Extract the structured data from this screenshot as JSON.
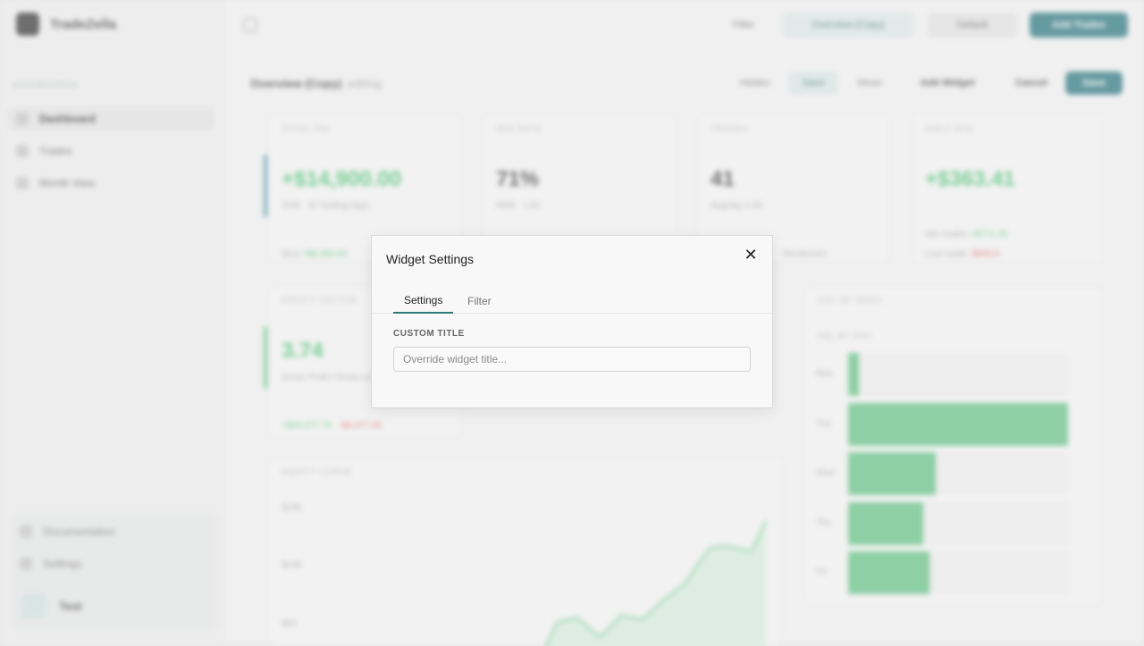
{
  "brand": {
    "name": "TradeZella"
  },
  "sidebar": {
    "section_label": "Dashboards",
    "items": [
      {
        "label": "Dashboard",
        "active": true
      },
      {
        "label": "Trades",
        "active": false
      },
      {
        "label": "Month View",
        "active": false
      }
    ],
    "footer": [
      {
        "label": "Documentation"
      },
      {
        "label": "Settings"
      }
    ],
    "user": {
      "name": "Test"
    }
  },
  "header": {
    "filter_label": "Filter",
    "dashboard_select": "Overview (Copy)",
    "account_select": "Default",
    "add_trades_label": "Add Trades"
  },
  "pagebar": {
    "title": "Overview (Copy)",
    "title_suffix": "editing",
    "buttons": [
      "Hidden",
      "Save",
      "Move",
      "Add Widget",
      "Cancel",
      "Save"
    ]
  },
  "widgets": {
    "total_pnl": {
      "label": "Total P&L",
      "value": "+$14,900.00",
      "sub": "ZOR · 97 trading days",
      "foot_label": "Best",
      "foot_value": "+$6,350.63"
    },
    "win_rate": {
      "label": "Win Rate",
      "value": "71%",
      "sub": "RRR · 1.81"
    },
    "trades": {
      "label": "Trades",
      "value": "41",
      "sub": "Avg/day 1.60",
      "foot": "Breakeven"
    },
    "daily_avg": {
      "label": "Daily Avg",
      "value": "+$363.41",
      "sub_left": "Win trades",
      "sub_right": "+$771.20",
      "foot_left": "Loss trade",
      "foot_right": "-$893.8"
    },
    "profit_factor": {
      "label": "Profit Factor",
      "value": "3.74",
      "sub": "Gross Profit / Gross Loss",
      "foot_left": "+$20,377.76",
      "foot_right": "-$5,477.65"
    },
    "equity_curve": {
      "label": "Equity Curve",
      "y_ticks": [
        "$15K",
        "$10K",
        "$5K"
      ]
    },
    "day_of_week": {
      "label": "Day of Week",
      "sub_label": "P&L by day",
      "days": [
        "Mon",
        "Tue",
        "Wed",
        "Thu",
        "Fri"
      ],
      "values": [
        0.05,
        1.0,
        0.4,
        0.34,
        0.37
      ]
    }
  },
  "modal": {
    "title": "Widget Settings",
    "close_glyph": "✕",
    "tabs": [
      {
        "label": "Settings",
        "active": true
      },
      {
        "label": "Filter",
        "active": false
      }
    ],
    "custom_title_label": "Custom Title",
    "custom_title_placeholder": "Override widget title...",
    "custom_title_value": ""
  },
  "colors": {
    "accent": "#2e7b7a",
    "primary_button": "#1f6f7a",
    "positive": "#3fbf6a",
    "negative": "#e05555"
  }
}
